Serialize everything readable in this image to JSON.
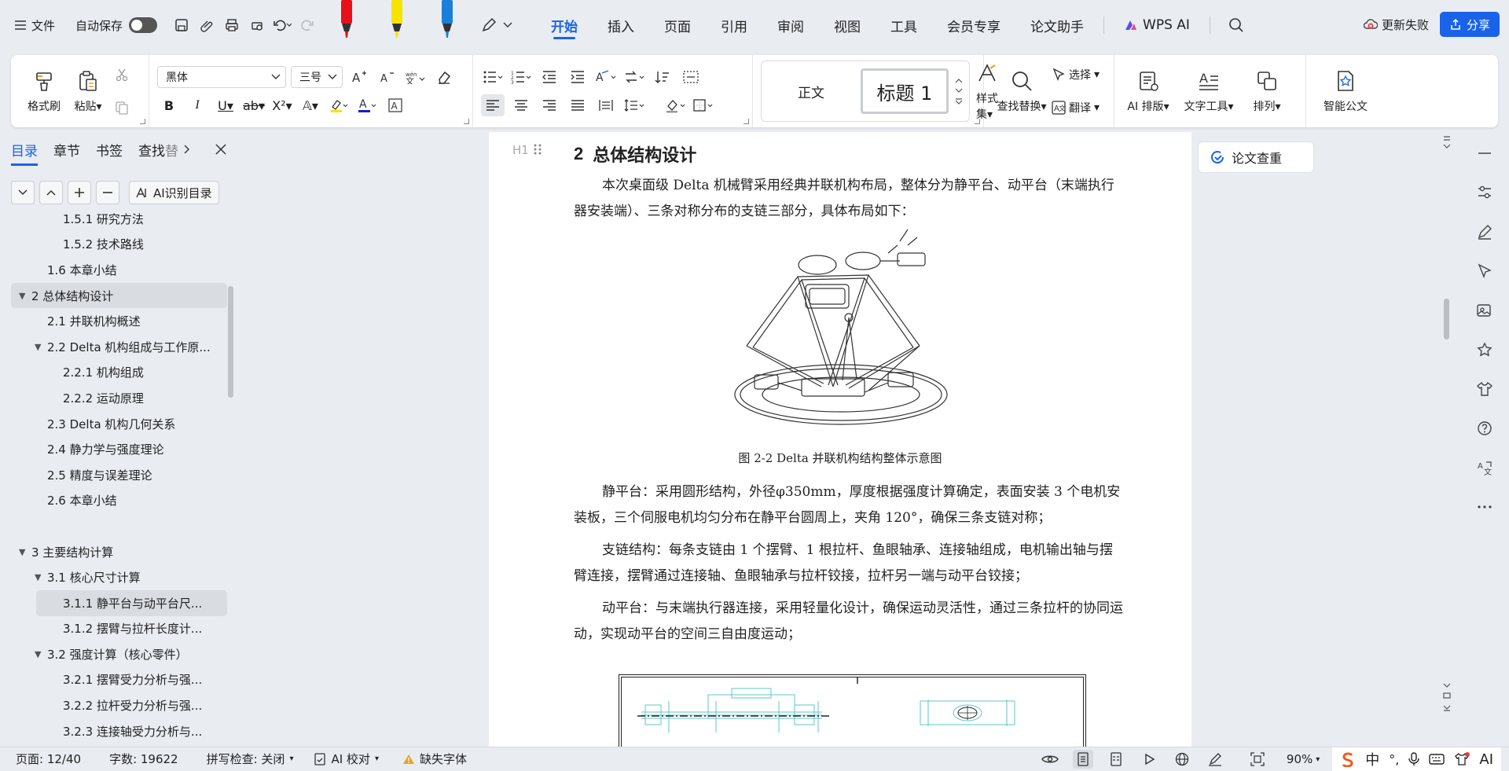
{
  "titlebar": {
    "file_menu": "文件",
    "autosave": "自动保存",
    "tabs": [
      "开始",
      "插入",
      "页面",
      "引用",
      "审阅",
      "视图",
      "工具",
      "会员专享",
      "论文助手"
    ],
    "wps_ai": "WPS AI",
    "update_failed": "更新失败",
    "share": "分享",
    "marker_colors": [
      "#e8101a",
      "#f5e400",
      "#1a7fd8"
    ]
  },
  "ribbon": {
    "format_painter": "格式刷",
    "paste": "粘贴",
    "font_name": "黑体",
    "font_size": "三号",
    "style_normal": "正文",
    "style_heading1": "标题 1",
    "style_set": "样式集",
    "find_replace": "查找替换",
    "select": "选择",
    "translate": "翻译",
    "ai_layout": "AI 排版",
    "text_tools": "文字工具",
    "arrange": "排列",
    "smart_doc": "智能公文"
  },
  "left_panel": {
    "tabs": [
      "目录",
      "章节",
      "书签",
      "查找"
    ],
    "ai_toc": "AI识别目录",
    "toc": [
      {
        "text": "1.5.1 研究方法",
        "level": 3,
        "caret": ""
      },
      {
        "text": "1.5.2 技术路线",
        "level": 3,
        "caret": ""
      },
      {
        "text": "1.6 本章小结",
        "level": 2,
        "caret": ""
      },
      {
        "text": "2 总体结构设计",
        "level": 1,
        "caret": "▼",
        "highlight": true
      },
      {
        "text": "2.1 并联机构概述",
        "level": 2,
        "caret": ""
      },
      {
        "text": "2.2 Delta 机构组成与工作原...",
        "level": 2,
        "caret": "▼"
      },
      {
        "text": "2.2.1 机构组成",
        "level": 3,
        "caret": ""
      },
      {
        "text": "2.2.2 运动原理",
        "level": 3,
        "caret": ""
      },
      {
        "text": "2.3 Delta 机构几何关系",
        "level": 2,
        "caret": ""
      },
      {
        "text": "2.4 静力学与强度理论",
        "level": 2,
        "caret": ""
      },
      {
        "text": "2.5 精度与误差理论",
        "level": 2,
        "caret": ""
      },
      {
        "text": "2.6 本章小结",
        "level": 2,
        "caret": ""
      },
      {
        "text": "",
        "level": 1,
        "caret": ""
      },
      {
        "text": "3 主要结构计算",
        "level": 1,
        "caret": "▼"
      },
      {
        "text": "3.1 核心尺寸计算",
        "level": 2,
        "caret": "▼"
      },
      {
        "text": "3.1.1 静平台与动平台尺...",
        "level": 3,
        "caret": "",
        "highlight": true
      },
      {
        "text": "3.1.2 摆臂与拉杆长度计...",
        "level": 3,
        "caret": ""
      },
      {
        "text": "3.2 强度计算（核心零件）",
        "level": 2,
        "caret": "▼"
      },
      {
        "text": "3.2.1 摆臂受力分析与强...",
        "level": 3,
        "caret": ""
      },
      {
        "text": "3.2.2 拉杆受力分析与强...",
        "level": 3,
        "caret": ""
      },
      {
        "text": "3.2.3 连接轴受力分析与...",
        "level": 3,
        "caret": ""
      }
    ]
  },
  "document": {
    "heading_mark": "H1",
    "heading_number": "2",
    "heading": "总体结构设计",
    "p1": "本次桌面级 Delta 机械臂采用经典并联机构布局，整体分为静平台、动平台（末端执行器安装端）、三条对称分布的支链三部分，具体布局如下：",
    "caption": "图 2-2 Delta 并联机构结构整体示意图",
    "p2": "静平台：采用圆形结构，外径φ350mm，厚度根据强度计算确定，表面安装 3 个电机安装板，三个伺服电机均匀分布在静平台圆周上，夹角 120°，确保三条支链对称；",
    "p3": "支链结构：每条支链由 1 个摆臂、1 根拉杆、鱼眼轴承、连接轴组成，电机输出轴与摆臂连接，摆臂通过连接轴、鱼眼轴承与拉杆铰接，拉杆另一端与动平台铰接；",
    "p4": "动平台：与末端执行器连接，采用轻量化设计，确保运动灵活性，通过三条拉杆的协同运动，实现动平台的空间三自由度运动；",
    "comment_check": "论文查重"
  },
  "statusbar": {
    "page": "页面: 12/40",
    "words": "字数: 19622",
    "spell": "拼写检查: 关闭",
    "ai_check": "AI 校对",
    "missing_font": "缺失字体",
    "zoom": "90%"
  },
  "ime": {
    "lang": "中",
    "ai": "AI"
  }
}
